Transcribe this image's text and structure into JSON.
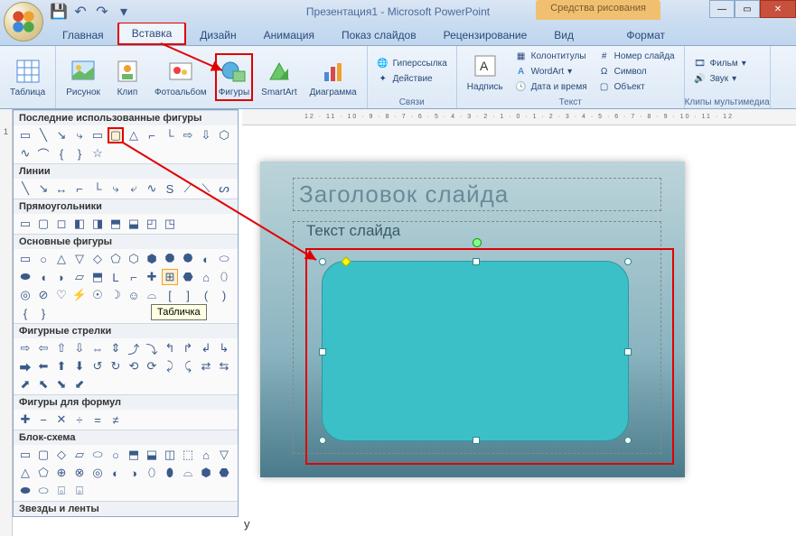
{
  "app": {
    "title": "Презентация1 - Microsoft PowerPoint",
    "context_tools": "Средства рисования"
  },
  "qat": {
    "save": "💾",
    "undo": "↶",
    "redo": "↷"
  },
  "tabs": {
    "home": "Главная",
    "insert": "Вставка",
    "design": "Дизайн",
    "animation": "Анимация",
    "slideshow": "Показ слайдов",
    "review": "Рецензирование",
    "view": "Вид",
    "format": "Формат"
  },
  "ribbon": {
    "table": "Таблица",
    "picture": "Рисунок",
    "clip": "Клип",
    "album": "Фотоальбом",
    "shapes": "Фигуры",
    "smartart": "SmartArt",
    "chart": "Диаграмма",
    "hyperlink": "Гиперссылка",
    "action": "Действие",
    "textbox": "Надпись",
    "headerfooter": "Колонтитулы",
    "wordart": "WordArt",
    "datetime": "Дата и время",
    "slidenum": "Номер слайда",
    "symbol": "Символ",
    "object": "Объект",
    "movie": "Фильм",
    "sound": "Звук",
    "group_links": "Связи",
    "group_text": "Текст",
    "group_media": "Клипы мультимедиа"
  },
  "shapes_panel": {
    "recent": "Последние использованные фигуры",
    "lines": "Линии",
    "rects": "Прямоугольники",
    "basic": "Основные фигуры",
    "arrows": "Фигурные стрелки",
    "formulas": "Фигуры для формул",
    "flowchart": "Блок-схема",
    "stars": "Звезды и ленты",
    "tooltip": "Табличка"
  },
  "slide": {
    "title": "Заголовок слайда",
    "body": "Текст слайда"
  },
  "ruler": "12 · 11 · 10 · 9 · 8 · 7 · 6 · 5 · 4 · 3 · 2 · 1 · 0 · 1 · 2 · 3 · 4 · 5 · 6 · 7 · 8 · 9 · 10 · 11 · 12",
  "bottom": "у"
}
